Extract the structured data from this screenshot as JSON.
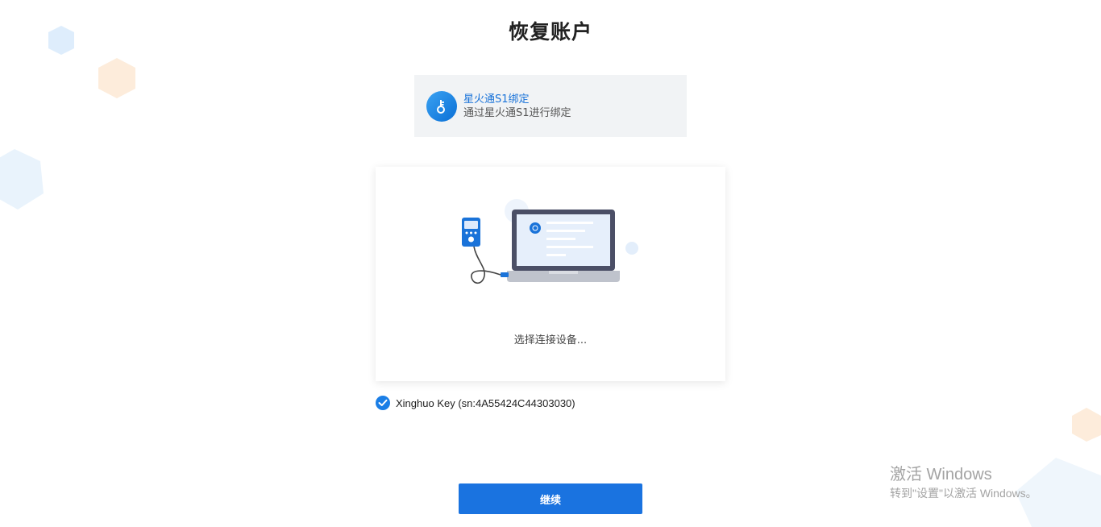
{
  "page": {
    "title": "恢复账户"
  },
  "method": {
    "title": "星火通S1绑定",
    "description": "通过星火通S1进行绑定",
    "icon": "key-icon",
    "accent": "#1a73d9"
  },
  "device_panel": {
    "illustration": "laptop-usb-key-illustration",
    "status": "选择连接设备..."
  },
  "device_option": {
    "label": "Xinghuo Key (sn:4A55424C44303030)",
    "checked": true
  },
  "actions": {
    "continue_label": "继续",
    "color": "#1a73e0"
  },
  "watermark": {
    "line1": "激活 Windows",
    "line2": "转到\"设置\"以激活 Windows。"
  }
}
